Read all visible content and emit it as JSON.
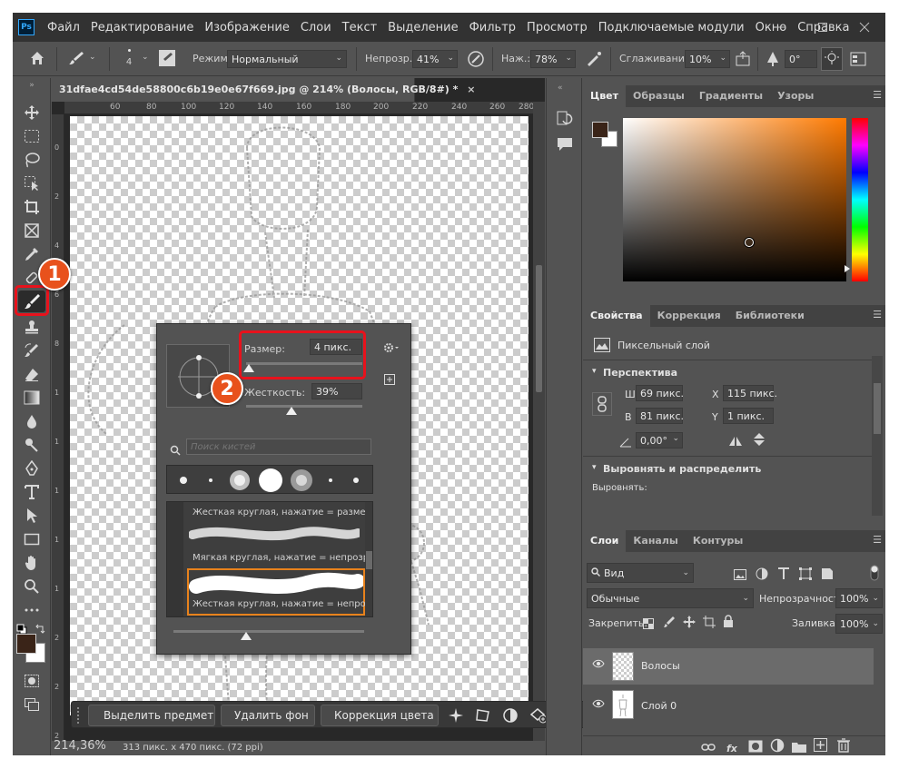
{
  "menu": {
    "logo": "Ps",
    "items": [
      "Файл",
      "Редактирование",
      "Изображение",
      "Слои",
      "Текст",
      "Выделение",
      "Фильтр",
      "Просмотр",
      "Подключаемые модули",
      "Окно",
      "Справка"
    ]
  },
  "options": {
    "brush_size_value": "4",
    "mode_label": "Режим:",
    "mode_value": "Нормальный",
    "opacity_label": "Непрозр.:",
    "opacity_value": "41%",
    "flow_label": "Наж.:",
    "flow_value": "78%",
    "smoothing_label": "Сглаживание:",
    "smoothing_value": "10%",
    "angle_value": "0°"
  },
  "document": {
    "tab_title": "31dfae4cd54de58800c6b19e0e67f669.jpg @ 214% (Волосы, RGB/8#) *",
    "ruler_h": [
      "60",
      "80",
      "100",
      "120",
      "140",
      "160",
      "180",
      "200",
      "220",
      "240",
      "260",
      "280"
    ],
    "ruler_v": [
      "0",
      "2",
      "4",
      "6",
      "8",
      "1",
      "1",
      "1",
      "1",
      "1",
      "2",
      "2",
      "2"
    ],
    "zoom": "214,36%",
    "dims": "313 пикс. x 470 пикс. (72 ppi)"
  },
  "taskbar": {
    "select_subject": "Выделить предмет",
    "remove_bg": "Удалить фон",
    "color_correction": "Коррекция цвета"
  },
  "brush_popup": {
    "size_label": "Размер:",
    "size_value": "4 пикс.",
    "hardness_label": "Жесткость:",
    "hardness_value": "39%",
    "size_fraction": 0.02,
    "hardness_fraction": 0.39,
    "search_placeholder": "Поиск кистей",
    "presets": [
      {
        "name": "Жесткая круглая, нажатие = размер"
      },
      {
        "name": "Мягкая круглая, нажатие = непрозр"
      },
      {
        "name": "Жесткая круглая, нажатие = непрозр"
      }
    ]
  },
  "callouts": {
    "one": "1",
    "two": "2"
  },
  "color_panel": {
    "tabs": [
      "Цвет",
      "Образцы",
      "Градиенты",
      "Узоры"
    ],
    "fg_color": "#3a2418",
    "bg_color": "#ffffff",
    "hue_color": "#ff7a00"
  },
  "properties_panel": {
    "tabs": [
      "Свойства",
      "Коррекция",
      "Библиотеки"
    ],
    "layer_type": "Пиксельный слой",
    "section_transform": "Перспектива",
    "w_label": "Ш",
    "w_value": "69 пикс.",
    "h_label": "В",
    "h_value": "81 пикс.",
    "x_label": "X",
    "x_value": "115 пикс.",
    "y_label": "Y",
    "y_value": "1 пикс.",
    "angle_value": "0,00°",
    "section_align": "Выровнять и распределить",
    "align_label": "Выровнять:"
  },
  "layers_panel": {
    "tabs": [
      "Слои",
      "Каналы",
      "Контуры"
    ],
    "filter_value": "Вид",
    "blend_mode": "Обычные",
    "opacity_label": "Непрозрачность:",
    "opacity_value": "100%",
    "lock_label": "Закрепить:",
    "fill_label": "Заливка:",
    "fill_value": "100%",
    "layers": [
      {
        "name": "Волосы"
      },
      {
        "name": "Слой 0"
      }
    ]
  }
}
